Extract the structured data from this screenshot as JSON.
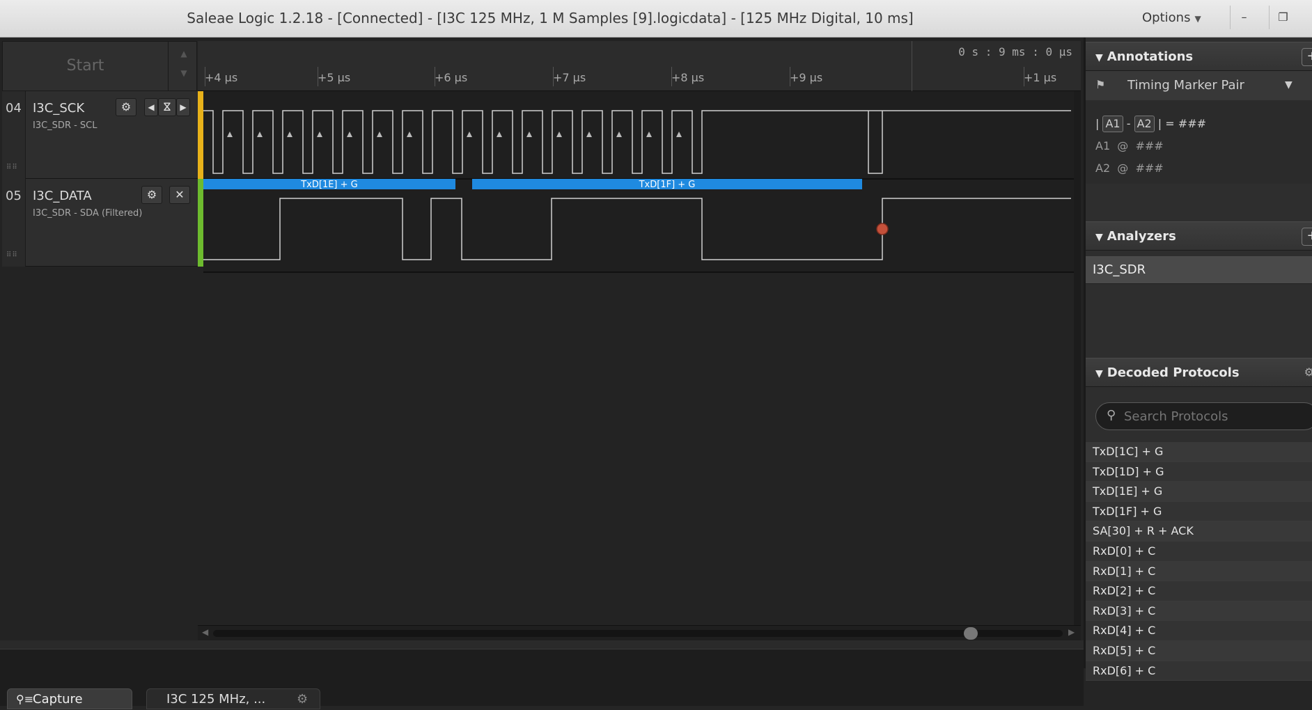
{
  "window": {
    "title": "Saleae Logic 1.2.18 - [Connected] - [I3C 125 MHz, 1 M Samples [9].logicdata] - [125 MHz Digital, 10 ms]",
    "options_label": "Options",
    "minimize_glyph": "–",
    "restore_glyph": "❐"
  },
  "toolbar": {
    "start_label": "Start",
    "timestamp": "0 s : 9 ms : 0 µs"
  },
  "timeline": {
    "ticks": [
      "+4 µs",
      "+5 µs",
      "+6 µs",
      "+7 µs",
      "+8 µs",
      "+9 µs",
      "+1 µs"
    ]
  },
  "channels": [
    {
      "number": "04",
      "name": "I3C_SCK",
      "subtitle": "I3C_SDR - SCL",
      "color": "#e8b21a"
    },
    {
      "number": "05",
      "name": "I3C_DATA",
      "subtitle": "I3C_SDR - SDA (Filtered)",
      "color": "#6dbb2e"
    }
  ],
  "decoded_frames": [
    {
      "label": "TxD[1E] + G"
    },
    {
      "label": "TxD[1F] + G"
    }
  ],
  "colors": {
    "frame_blue": "#1f8ae0",
    "marker_red": "#c4503a",
    "wave": "#d0d0d0"
  },
  "annotations": {
    "title": "Annotations",
    "marker_pair_label": "Timing Marker Pair",
    "a1": "A1",
    "a2": "A2",
    "placeholder": "###",
    "at": "@",
    "eq": "=",
    "dash": "-",
    "bar": "|"
  },
  "analyzers": {
    "title": "Analyzers",
    "items": [
      "I3C_SDR"
    ]
  },
  "decoded_protocols": {
    "title": "Decoded Protocols",
    "search_placeholder": "Search Protocols",
    "items": [
      "TxD[1C] + G",
      "TxD[1D] + G",
      "TxD[1E] + G",
      "TxD[1F] + G",
      "SA[30] + R + ACK",
      "RxD[0] + C",
      "RxD[1] + C",
      "RxD[2] + C",
      "RxD[3] + C",
      "RxD[4] + C",
      "RxD[5] + C",
      "RxD[6] + C"
    ]
  },
  "tabs": {
    "capture_label": "Capture",
    "session_label": "I3C 125 MHz, ..."
  }
}
